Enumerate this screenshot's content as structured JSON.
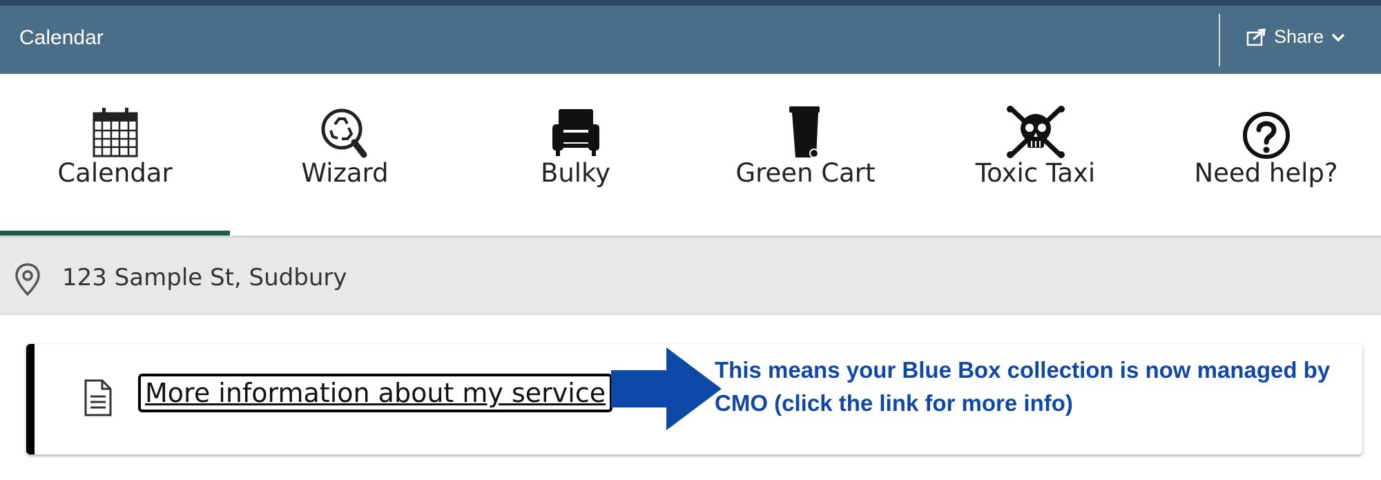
{
  "header": {
    "title": "Calendar",
    "share_label": "Share"
  },
  "tabs": [
    {
      "label": "Calendar",
      "icon": "calendar-icon"
    },
    {
      "label": "Wizard",
      "icon": "recycle-search-icon"
    },
    {
      "label": "Bulky",
      "icon": "armchair-icon"
    },
    {
      "label": "Green Cart",
      "icon": "green-cart-bin-icon"
    },
    {
      "label": "Toxic Taxi",
      "icon": "skull-crossbones-icon"
    },
    {
      "label": "Need help?",
      "icon": "question-circle-icon"
    }
  ],
  "active_tab": "Calendar",
  "address": {
    "text": "123 Sample St, Sudbury",
    "icon": "map-pin-icon"
  },
  "info_card": {
    "link_label": "More information about my service",
    "icon": "document-icon",
    "annotation": "This means your Blue Box collection is now managed by CMO (click the link for more info)"
  },
  "colors": {
    "header_bg": "#4a6e87",
    "active_tab_underline": "#1f5f45",
    "annotation_text": "#1048a8",
    "arrow": "#0d4aa8"
  }
}
